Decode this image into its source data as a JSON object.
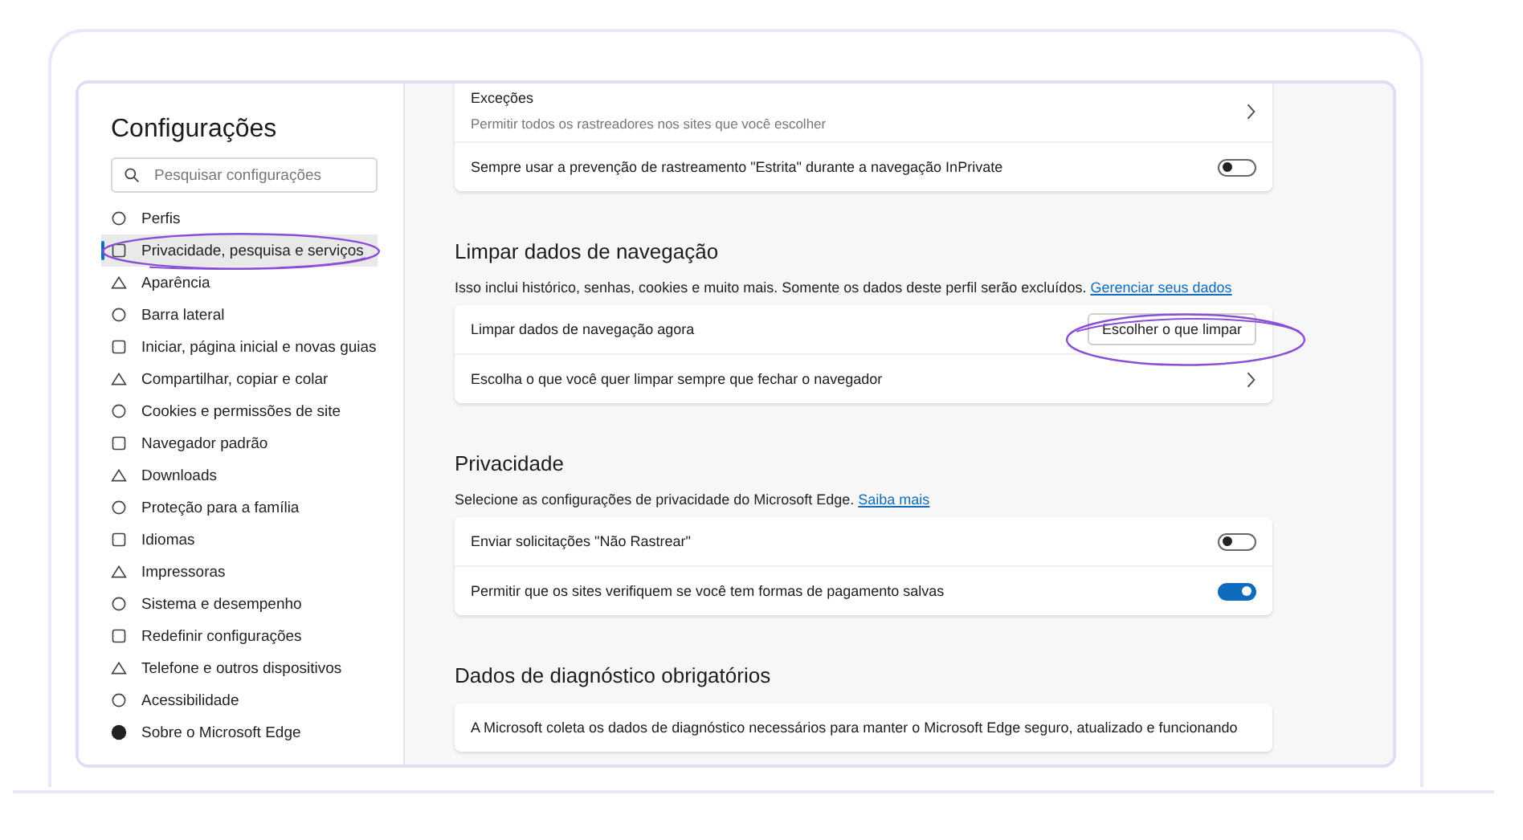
{
  "sidebar": {
    "title": "Configurações",
    "search": {
      "placeholder": "Pesquisar configurações"
    },
    "items": [
      {
        "label": "Perfis",
        "selected": false
      },
      {
        "label": "Privacidade, pesquisa e serviços",
        "selected": true
      },
      {
        "label": "Aparência",
        "selected": false
      },
      {
        "label": "Barra lateral",
        "selected": false
      },
      {
        "label": "Iniciar, página inicial e novas guias",
        "selected": false
      },
      {
        "label": "Compartilhar, copiar e colar",
        "selected": false
      },
      {
        "label": "Cookies e permissões de site",
        "selected": false
      },
      {
        "label": "Navegador padrão",
        "selected": false
      },
      {
        "label": "Downloads",
        "selected": false
      },
      {
        "label": "Proteção para a família",
        "selected": false
      },
      {
        "label": "Idiomas",
        "selected": false
      },
      {
        "label": "Impressoras",
        "selected": false
      },
      {
        "label": "Sistema e desempenho",
        "selected": false
      },
      {
        "label": "Redefinir configurações",
        "selected": false
      },
      {
        "label": "Telefone e outros dispositivos",
        "selected": false
      },
      {
        "label": "Acessibilidade",
        "selected": false
      },
      {
        "label": "Sobre o Microsoft Edge",
        "selected": false
      }
    ]
  },
  "sections": [
    {
      "rows": [
        {
          "kind": "link",
          "label": "Exceções",
          "sublabel": "Permitir todos os rastreadores nos sites que você escolher"
        },
        {
          "kind": "toggle",
          "label": "Sempre usar a prevenção de rastreamento \"Estrita\" durante a navegação InPrivate",
          "on": false
        }
      ]
    },
    {
      "heading": "Limpar dados de navegação",
      "description": "Isso inclui histórico, senhas, cookies e muito mais. Somente os dados deste perfil serão excluídos.",
      "link": "Gerenciar seus dados",
      "rows": [
        {
          "kind": "button",
          "label": "Limpar dados de navegação agora",
          "button": "Escolher o que limpar"
        },
        {
          "kind": "link",
          "label": "Escolha o que você quer limpar sempre que fechar o navegador"
        }
      ]
    },
    {
      "heading": "Privacidade",
      "description": "Selecione as configurações de privacidade do Microsoft Edge.",
      "link": "Saiba mais",
      "rows": [
        {
          "kind": "toggle",
          "label": "Enviar solicitações \"Não Rastrear\"",
          "on": false
        },
        {
          "kind": "toggle",
          "label": "Permitir que os sites verifiquem se você tem formas de pagamento salvas",
          "on": true
        }
      ]
    },
    {
      "heading": "Dados de diagnóstico obrigatórios",
      "rows": [
        {
          "kind": "text",
          "label": "A Microsoft coleta os dados de diagnóstico necessários para manter o Microsoft Edge seguro, atualizado e funcionando"
        }
      ]
    }
  ]
}
